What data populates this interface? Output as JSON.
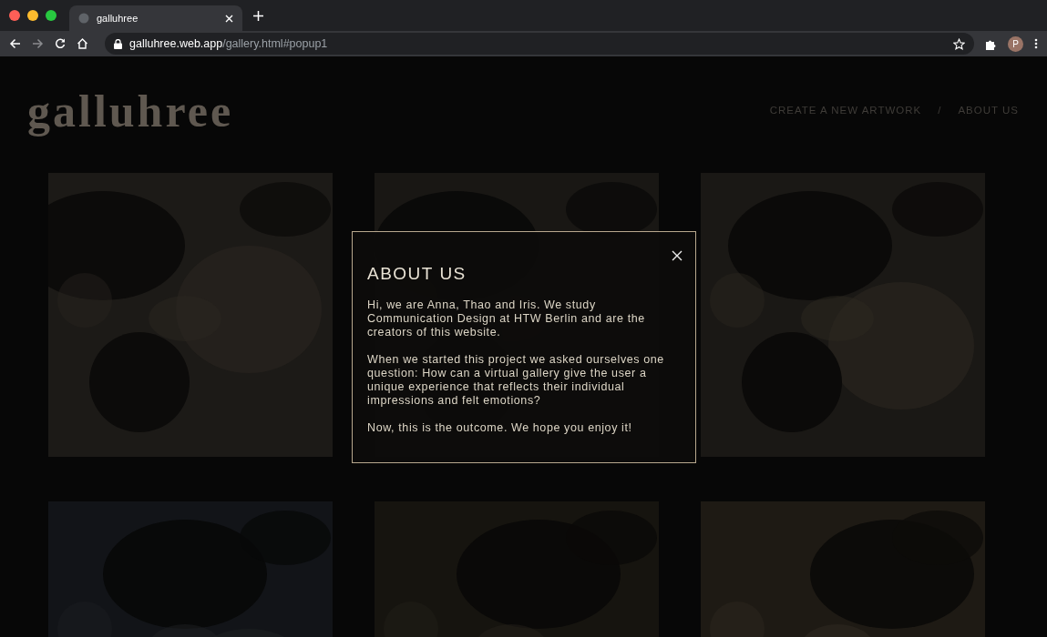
{
  "browser": {
    "tab_title": "galluhree",
    "url_host": "galluhree.web.app",
    "url_path": "/gallery.html#popup1",
    "profile_initial": "P"
  },
  "site": {
    "logo": "galluhree",
    "nav": [
      "CREATE A NEW ARTWORK",
      "ABOUT US"
    ],
    "nav_separator": "/"
  },
  "popup": {
    "title": "ABOUT US",
    "paragraphs": [
      "Hi, we are Anna, Thao and Iris. We study Communication Design at HTW Berlin and are the creators of this website.",
      "When we started this project we asked ourselves one question: How can a virtual gallery give the user a unique experience that reflects their individual impressions and felt emotions?",
      "Now, this is the outcome. We hope you enjoy it!"
    ]
  }
}
